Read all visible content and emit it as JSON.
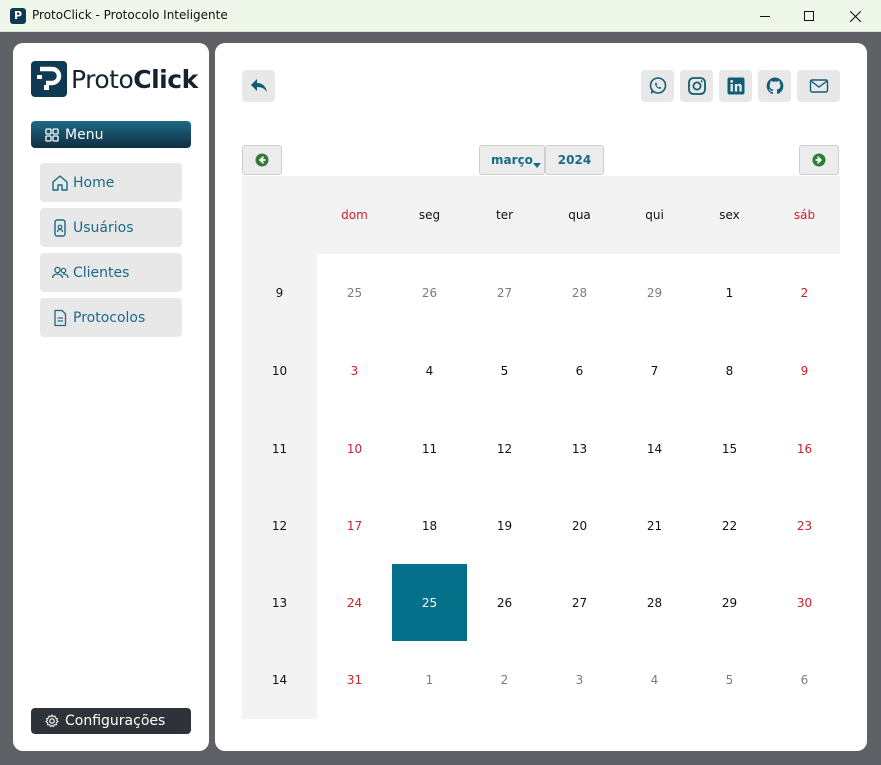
{
  "window": {
    "title": "ProtoClick - Protocolo Inteligente",
    "icon": "protoclick-app-icon",
    "controls": [
      "minimize",
      "maximize",
      "close"
    ]
  },
  "sidebar": {
    "logo_text_light": "Proto",
    "logo_text_bold": "Click",
    "menu_label": "Menu",
    "items": [
      {
        "label": "Home",
        "icon": "home-icon"
      },
      {
        "label": "Usuários",
        "icon": "phone-user-icon"
      },
      {
        "label": "Clientes",
        "icon": "users-icon"
      },
      {
        "label": "Protocolos",
        "icon": "document-icon"
      }
    ],
    "config_label": "Configurações"
  },
  "toolbar": {
    "back_icon": "reply-arrow-icon",
    "social": [
      "whatsapp-icon",
      "instagram-icon",
      "linkedin-icon",
      "github-icon",
      "mail-icon"
    ]
  },
  "calendar": {
    "month": "março",
    "year": "2024",
    "weekdays": [
      "dom",
      "seg",
      "ter",
      "qua",
      "qui",
      "sex",
      "sáb"
    ],
    "weeks": [
      {
        "num": "9",
        "days": [
          "25",
          "26",
          "27",
          "28",
          "29",
          "1",
          "2"
        ]
      },
      {
        "num": "10",
        "days": [
          "3",
          "4",
          "5",
          "6",
          "7",
          "8",
          "9"
        ]
      },
      {
        "num": "11",
        "days": [
          "10",
          "11",
          "12",
          "13",
          "14",
          "15",
          "16"
        ]
      },
      {
        "num": "12",
        "days": [
          "17",
          "18",
          "19",
          "20",
          "21",
          "22",
          "23"
        ]
      },
      {
        "num": "13",
        "days": [
          "24",
          "25",
          "26",
          "27",
          "28",
          "29",
          "30"
        ]
      },
      {
        "num": "14",
        "days": [
          "31",
          "1",
          "2",
          "3",
          "4",
          "5",
          "6"
        ]
      }
    ],
    "selected_day": "25",
    "colors": {
      "accent": "#047089",
      "weekend": "#cc1f2a",
      "other_month": "#7c7c7c"
    }
  }
}
